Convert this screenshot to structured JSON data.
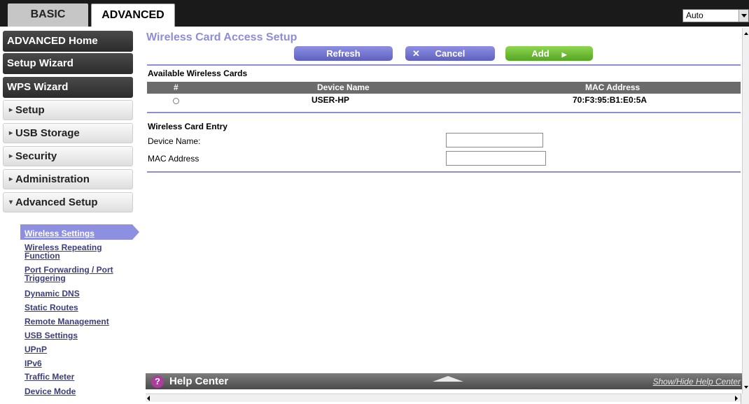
{
  "tabs": {
    "basic": "BASIC",
    "advanced": "ADVANCED"
  },
  "language": {
    "selected": "Auto"
  },
  "sidebar": {
    "dark_items": [
      "ADVANCED Home",
      "Setup Wizard",
      "WPS Wizard"
    ],
    "sections": [
      {
        "label": "Setup",
        "marker": "▸"
      },
      {
        "label": "USB Storage",
        "marker": "▸"
      },
      {
        "label": "Security",
        "marker": "▸"
      },
      {
        "label": "Administration",
        "marker": "▸"
      },
      {
        "label": "Advanced Setup",
        "marker": "▾"
      }
    ],
    "submenu": [
      "Wireless Settings",
      "Wireless Repeating Function",
      "Port Forwarding / Port Triggering",
      "Dynamic DNS",
      "Static Routes",
      "Remote Management",
      "USB Settings",
      "UPnP",
      "IPv6",
      "Traffic Meter",
      "Device Mode"
    ],
    "active_submenu": "Wireless Settings"
  },
  "main": {
    "title": "Wireless Card Access Setup",
    "buttons": {
      "refresh": "Refresh",
      "cancel": "Cancel",
      "add": "Add"
    },
    "available_title": "Available Wireless Cards",
    "table": {
      "headers": {
        "index": "#",
        "device": "Device Name",
        "mac": "MAC Address"
      },
      "rows": [
        {
          "device": "USER-HP",
          "mac": "70:F3:95:B1:E0:5A"
        }
      ]
    },
    "entry_title": "Wireless Card Entry",
    "fields": {
      "device_label": "Device Name:",
      "device_value": "",
      "mac_label": "MAC Address",
      "mac_value": ""
    }
  },
  "help": {
    "title": "Help Center",
    "toggle": "Show/Hide Help Center",
    "icon_glyph": "?"
  },
  "colors": {
    "accent": "#8d8ed7",
    "add_green": "#56a526",
    "help_icon": "#ab3d9c"
  }
}
